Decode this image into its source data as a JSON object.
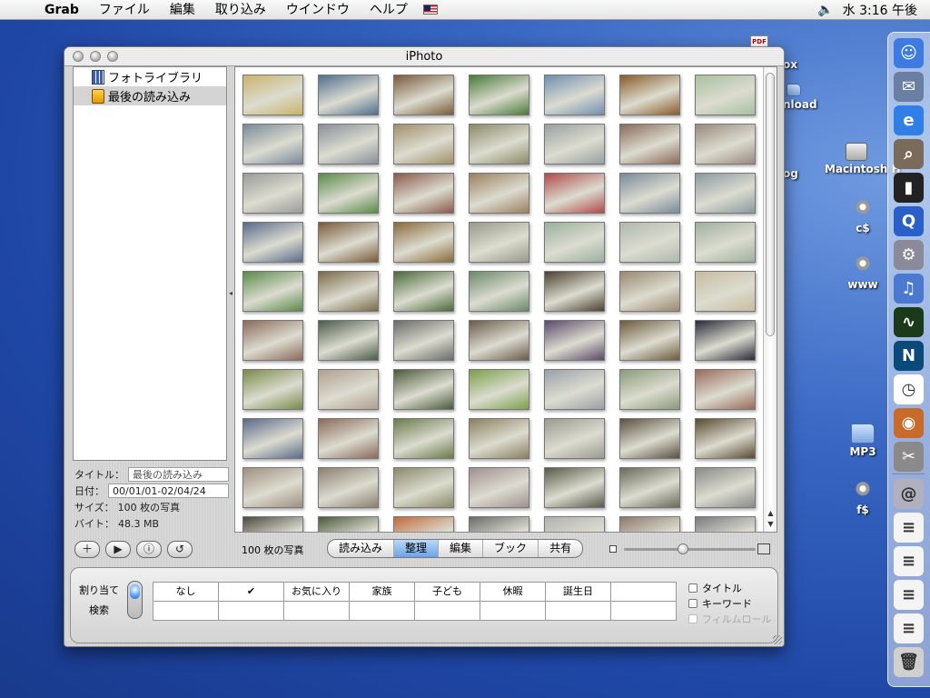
{
  "menubar": {
    "app_name": "Grab",
    "items": [
      "ファイル",
      "編集",
      "取り込み",
      "ウインドウ",
      "ヘルプ"
    ],
    "clock": "水 3:16 午後"
  },
  "desktop": {
    "items": [
      {
        "label": "ox",
        "icon": "folder-icon"
      },
      {
        "label": "nload",
        "icon": "folder-icon"
      },
      {
        "label": "og",
        "icon": "folder-icon"
      },
      {
        "label": "Macintosh H",
        "icon": "hard-disk-icon"
      },
      {
        "label": "c$",
        "icon": "network-volume-icon"
      },
      {
        "label": "www",
        "icon": "network-volume-icon"
      },
      {
        "label": "MP3",
        "icon": "folder-icon"
      },
      {
        "label": "f$",
        "icon": "network-volume-icon"
      }
    ],
    "pdf_badge": "PDF"
  },
  "window": {
    "title": "iPhoto",
    "source_list": [
      {
        "label": "フォトライブラリ",
        "icon": "photo-library-icon",
        "selected": false
      },
      {
        "label": "最後の読み込み",
        "icon": "film-roll-icon",
        "selected": true
      }
    ],
    "info": {
      "title_label": "タイトル：",
      "title_value": "最後の読み込み",
      "date_label": "日付：",
      "date_value": "00/01/01-02/04/24",
      "size_label": "サイズ：",
      "size_value": "100 枚の写真",
      "bytes_label": "バイト：",
      "bytes_value": "48.3 MB"
    },
    "photo_count": "100 枚の写真",
    "modes": [
      {
        "label": "読み込み",
        "active": false
      },
      {
        "label": "整理",
        "active": true
      },
      {
        "label": "編集",
        "active": false
      },
      {
        "label": "ブック",
        "active": false
      },
      {
        "label": "共有",
        "active": false
      }
    ],
    "zoom_level": 0.45,
    "photos": [
      "#c9b46a",
      "#4f6f8f",
      "#7a5a3a",
      "#4a7a3a",
      "#6f8fb0",
      "#8a5a2a",
      "#a8c0a0",
      "#7a8a9a",
      "#8a8f9a",
      "#a0906a",
      "#8a8a6a",
      "#9aa0a0",
      "#8a6a5a",
      "#9a8a80",
      "#9a9a9a",
      "#5a8a4a",
      "#8a5a4a",
      "#9a8060",
      "#b04a4a",
      "#7a8a9a",
      "#8a9aa0",
      "#5a6a8a",
      "#7a5a3a",
      "#8a6a3a",
      "#9a9a8a",
      "#9ab0a0",
      "#b0b8b0",
      "#a0b0a0",
      "#5a8a4a",
      "#7a6a4a",
      "#4a6a3a",
      "#6a8a6a",
      "#4a4030",
      "#9a8870",
      "#c8bca0",
      "#8a6a5a",
      "#4a5a4a",
      "#6a6a6a",
      "#6a5a4a",
      "#5a4a6a",
      "#6a5a3a",
      "#2a2a3a",
      "#7a8a4a",
      "#b0a090",
      "#4a5a3a",
      "#7aa04a",
      "#9aa0a8",
      "#8a9a7a",
      "#9a6a5a",
      "#5a6a8a",
      "#8a6a5a",
      "#6a7a4a",
      "#8a8060",
      "#9a9a90",
      "#5a5040",
      "#5a4a30",
      "#a09080",
      "#8a8070",
      "#8a8a6a",
      "#a09090",
      "#5a5a4a",
      "#6a6a5a",
      "#8a8a8a",
      "#4a4a40",
      "#4a5a3a",
      "#c06a3a",
      "#6a6a6a",
      "#b0b0b0",
      "#8a7a6a",
      "#7a7a80"
    ],
    "keywords": {
      "assign_label": "割り当て",
      "search_label": "検索",
      "cells": [
        "なし",
        "✔",
        "お気に入り",
        "家族",
        "子ども",
        "休暇",
        "誕生日",
        "",
        "",
        "",
        "",
        "",
        "",
        "",
        "",
        ""
      ],
      "checks": [
        {
          "label": "タイトル",
          "disabled": false
        },
        {
          "label": "キーワード",
          "disabled": false
        },
        {
          "label": "フィルムロール",
          "disabled": true
        }
      ]
    }
  },
  "dock": {
    "items": [
      {
        "name": "finder-icon",
        "color": "#3d7be0",
        "glyph": "☺"
      },
      {
        "name": "mail-icon",
        "color": "#6a7fa3",
        "glyph": "✉"
      },
      {
        "name": "internet-explorer-icon",
        "color": "#2f7fe6",
        "glyph": "e"
      },
      {
        "name": "sherlock-icon",
        "color": "#7a6a5a",
        "glyph": "⌕"
      },
      {
        "name": "terminal-icon",
        "color": "#222222",
        "glyph": "▮"
      },
      {
        "name": "quicktime-icon",
        "color": "#2a5fc8",
        "glyph": "Q"
      },
      {
        "name": "system-preferences-icon",
        "color": "#8a8a9a",
        "glyph": "⚙"
      },
      {
        "name": "itunes-icon",
        "color": "#4a7ad0",
        "glyph": "♫"
      },
      {
        "name": "activity-monitor-icon",
        "color": "#1a3a1a",
        "glyph": "∿"
      },
      {
        "name": "netscape-icon",
        "color": "#0a4a7a",
        "glyph": "N"
      },
      {
        "name": "clock-icon",
        "color": "#ffffff",
        "glyph": "◷"
      },
      {
        "name": "iphoto-icon",
        "color": "#c86a2a",
        "glyph": "◉"
      },
      {
        "name": "grab-icon",
        "color": "#8a8a8a",
        "glyph": "✂"
      },
      {
        "name": "mail-at-icon",
        "color": "#b0b0c0",
        "glyph": "@"
      },
      {
        "name": "document-icon-1",
        "color": "#f4f4f4",
        "glyph": "≡"
      },
      {
        "name": "document-icon-2",
        "color": "#f4f4f4",
        "glyph": "≡"
      },
      {
        "name": "document-icon-3",
        "color": "#f4f4f4",
        "glyph": "≡"
      },
      {
        "name": "document-icon-4",
        "color": "#f4f4f4",
        "glyph": "≡"
      },
      {
        "name": "trash-icon",
        "color": "#d0d0d0",
        "glyph": "🗑"
      }
    ]
  }
}
